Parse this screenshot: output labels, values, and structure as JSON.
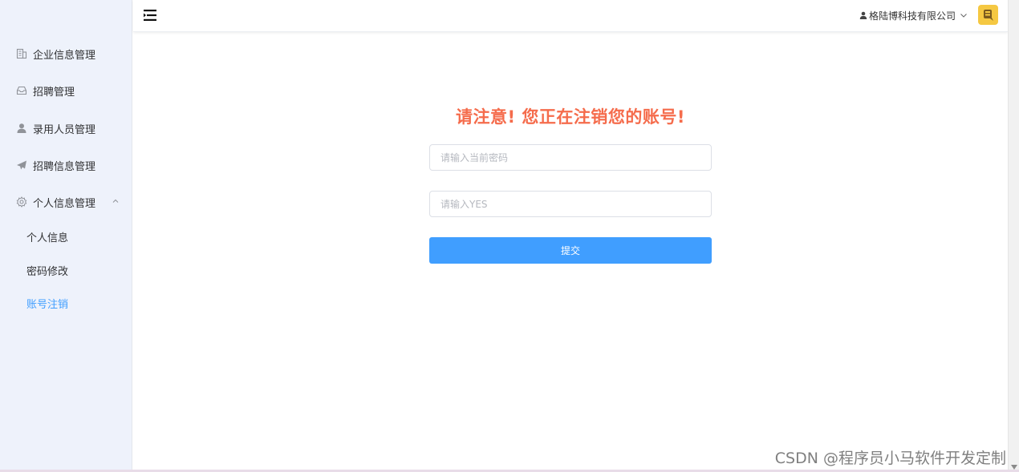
{
  "sidebar": {
    "menu": [
      {
        "label": "企业信息管理",
        "icon": "building-icon"
      },
      {
        "label": "招聘管理",
        "icon": "inbox-icon"
      },
      {
        "label": "录用人员管理",
        "icon": "user-icon"
      },
      {
        "label": "招聘信息管理",
        "icon": "paper-plane-icon"
      },
      {
        "label": "个人信息管理",
        "icon": "gear-icon",
        "expanded": true
      }
    ],
    "submenu": [
      {
        "label": "个人信息"
      },
      {
        "label": "密码修改"
      },
      {
        "label": "账号注销",
        "active": true
      }
    ]
  },
  "header": {
    "user_name": "格陆博科技有限公司"
  },
  "main": {
    "warning": "请注意! 您正在注销您的账号!",
    "password_placeholder": "请输入当前密码",
    "confirm_placeholder": "请输入YES",
    "submit_label": "提交"
  },
  "watermark": "CSDN @程序员小马软件开发定制",
  "colors": {
    "accent": "#409eff",
    "warning": "#f56c4c",
    "sidebar_bg": "#eef2fb"
  }
}
